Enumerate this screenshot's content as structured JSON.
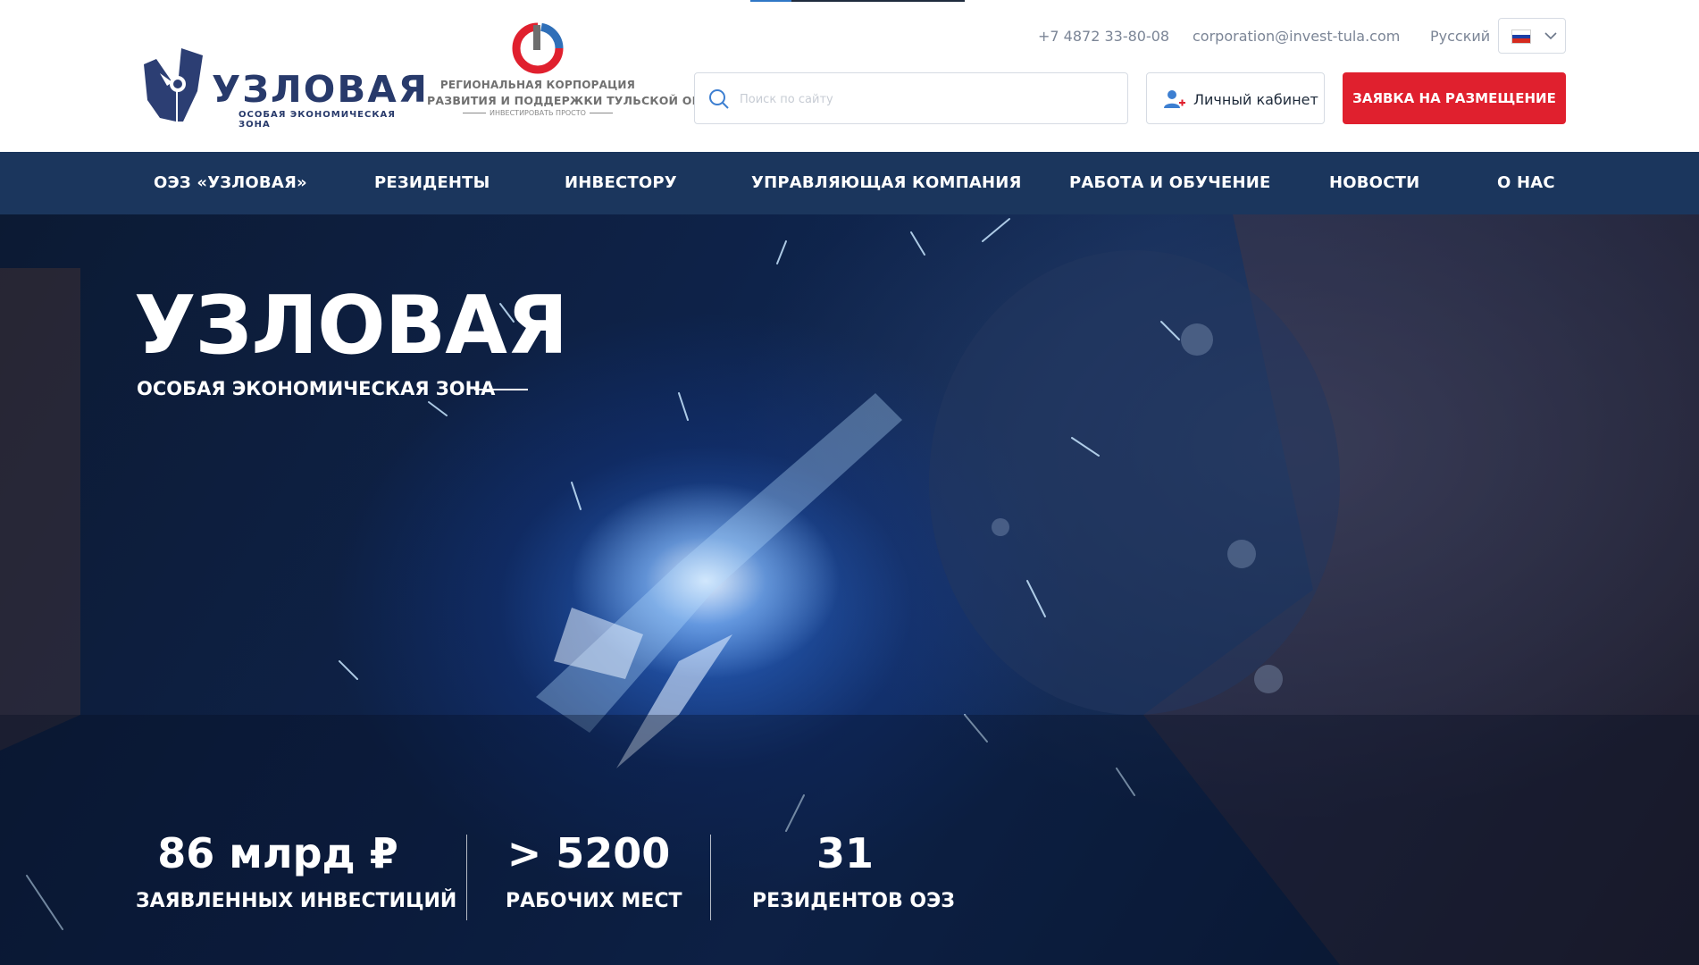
{
  "header": {
    "logo_main": {
      "word": "УЗЛОВАЯ",
      "sub": "ОСОБАЯ ЭКОНОМИЧЕСКАЯ ЗОНА"
    },
    "logo_corp": {
      "line1": "РЕГИОНАЛЬНАЯ КОРПОРАЦИЯ",
      "line2": "РАЗВИТИЯ И ПОДДЕРЖКИ ТУЛЬСКОЙ ОБЛАСТИ",
      "slogan": "ИНВЕСТИРОВАТЬ ПРОСТО"
    },
    "phone": "+7 4872 33-80-08",
    "email": "corporation@invest-tula.com",
    "language": {
      "label": "Русский",
      "flag": "russian-flag"
    },
    "search": {
      "placeholder": "Поиск по сайту",
      "value": ""
    },
    "cabinet_label": "Личный кабинет",
    "apply_label": "ЗАЯВКА НА РАЗМЕЩЕНИЕ"
  },
  "nav": {
    "items": [
      {
        "label": "ОЭЗ «УЗЛОВАЯ»"
      },
      {
        "label": "РЕЗИДЕНТЫ"
      },
      {
        "label": "ИНВЕСТОРУ"
      },
      {
        "label": "УПРАВЛЯЮЩАЯ КОМПАНИЯ"
      },
      {
        "label": "РАБОТА И ОБУЧЕНИЕ"
      },
      {
        "label": "НОВОСТИ"
      },
      {
        "label": "О НАС"
      }
    ]
  },
  "hero": {
    "title": "УЗЛОВАЯ",
    "subtitle": "ОСОБАЯ ЭКОНОМИЧЕСКАЯ ЗОНА",
    "stats": [
      {
        "value": "86 млрд ₽",
        "label": "ЗАЯВЛЕННЫХ ИНВЕСТИЦИЙ"
      },
      {
        "value": "> 5200",
        "label": "РАБОЧИХ МЕСТ"
      },
      {
        "value": "31",
        "label": "РЕЗИДЕНТОВ ОЭЗ"
      }
    ]
  },
  "colors": {
    "brand_navy": "#1b365d",
    "accent_red": "#e0202e",
    "logo_blue": "#283a6b"
  }
}
